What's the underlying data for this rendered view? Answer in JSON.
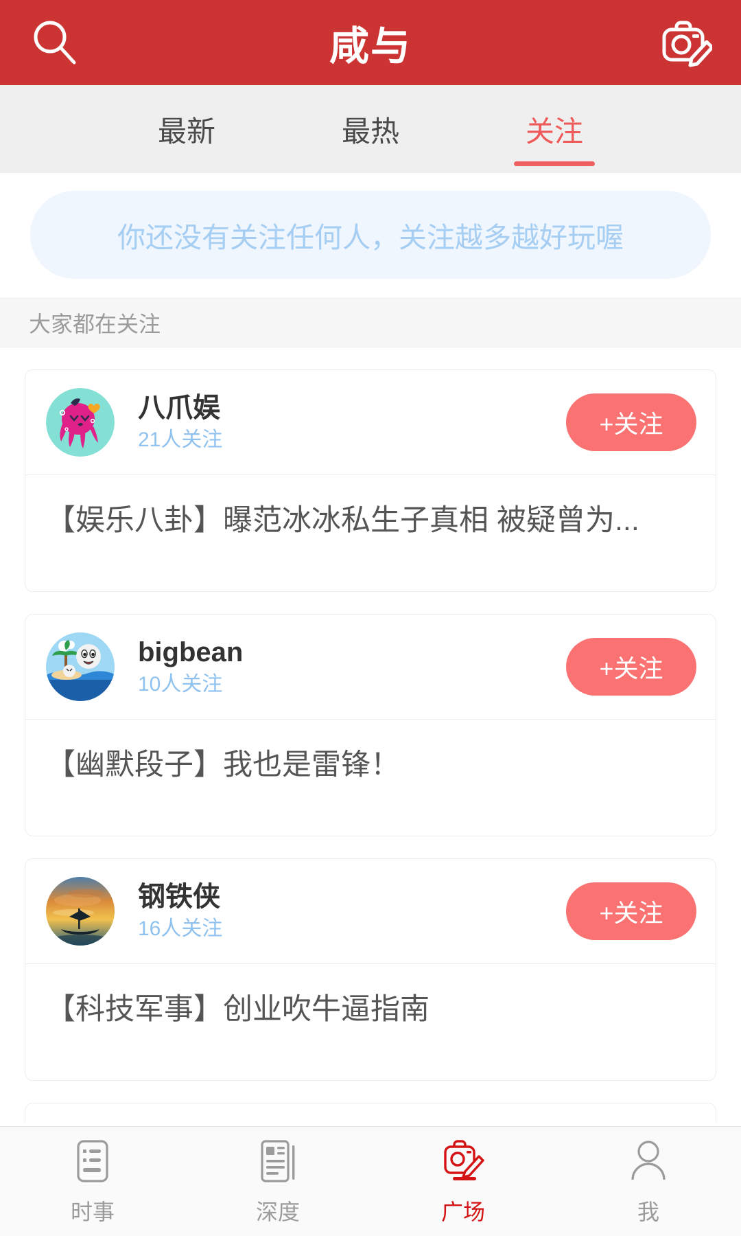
{
  "header": {
    "title": "咸与",
    "search_icon": "search-icon",
    "compose_icon": "camera-edit-icon",
    "background_color": "#cc3333"
  },
  "tabs": [
    {
      "label": "最新",
      "active": false
    },
    {
      "label": "最热",
      "active": false
    },
    {
      "label": "关注",
      "active": true
    }
  ],
  "notice": {
    "text": "你还没有关注任何人，关注越多越好玩喔",
    "text_color": "#a6cdf2",
    "background_color": "#eff6fd"
  },
  "section": {
    "title": "大家都在关注"
  },
  "cards": [
    {
      "username": "八爪娱",
      "followers": "21人关注",
      "follow_label": "+关注",
      "post_title": "【娱乐八卦】曝范冰冰私生子真相 被疑曾为...",
      "avatar": "octopus-avatar"
    },
    {
      "username": "bigbean",
      "followers": "10人关注",
      "follow_label": "+关注",
      "post_title": "【幽默段子】我也是雷锋！",
      "avatar": "island-avatar"
    },
    {
      "username": "钢铁侠",
      "followers": "16人关注",
      "follow_label": "+关注",
      "post_title": "【科技军事】创业吹牛逼指南",
      "avatar": "sunset-boat-avatar"
    }
  ],
  "bottom_nav": [
    {
      "label": "时事",
      "icon": "list-icon",
      "active": false
    },
    {
      "label": "深度",
      "icon": "article-icon",
      "active": false
    },
    {
      "label": "广场",
      "icon": "camera-edit-icon",
      "active": true
    },
    {
      "label": "我",
      "icon": "person-icon",
      "active": false
    }
  ],
  "colors": {
    "brand_red": "#cc3333",
    "accent_red": "#fa7272",
    "active_nav_red": "#d41414",
    "link_blue": "#8fc2ef"
  }
}
